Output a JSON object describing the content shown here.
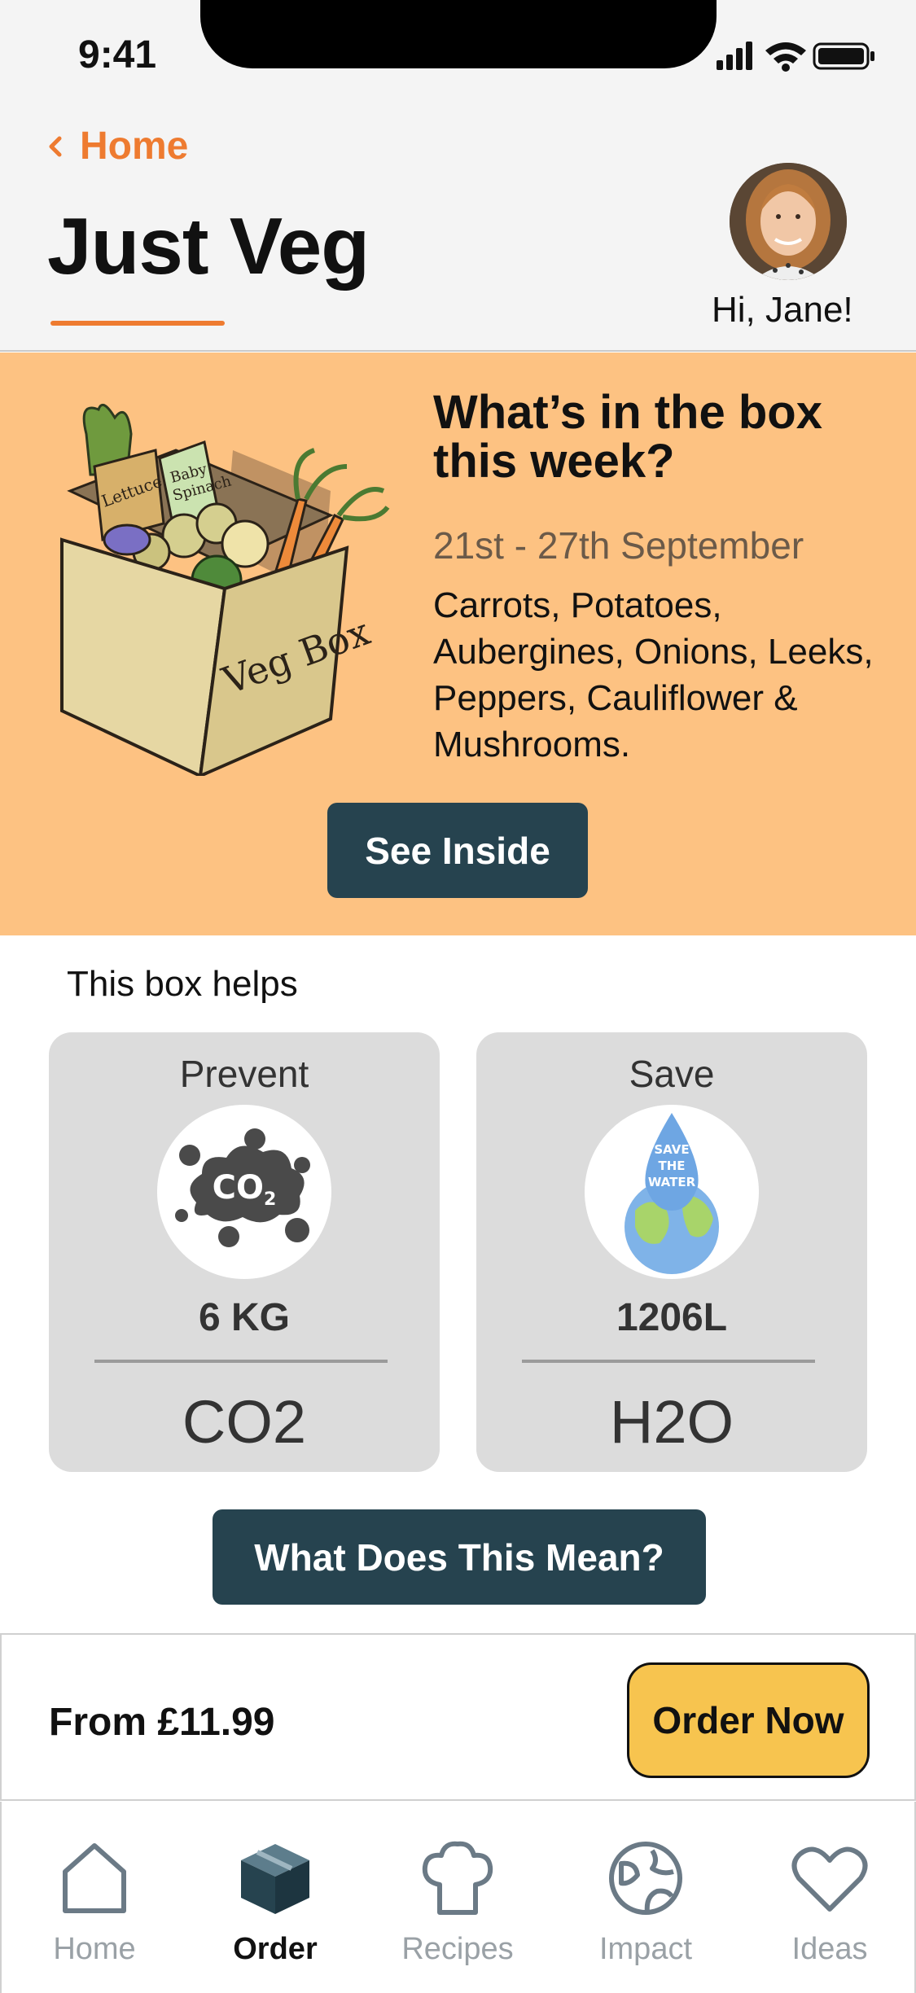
{
  "status_bar": {
    "time": "9:41"
  },
  "header": {
    "back_label": "Home",
    "title": "Just Veg",
    "greeting": "Hi, Jane!"
  },
  "banner": {
    "title": "What’s in the box this week?",
    "dates": "21st - 27th September",
    "items": "Carrots, Potatoes, Aubergines, Onions, Leeks, Peppers, Cauliflower & Mushrooms.",
    "button": "See Inside",
    "box_labels": [
      "Lettuce",
      "Baby Spinach",
      "Veg Box"
    ]
  },
  "helps": {
    "heading": "This box helps",
    "cards": [
      {
        "title": "Prevent",
        "amount": "6 KG",
        "unit": "CO2",
        "icon": "co2-cloud-icon",
        "icon_text": "CO2"
      },
      {
        "title": "Save",
        "amount": "1206L",
        "unit": "H2O",
        "icon": "water-drop-earth-icon",
        "icon_text": "SAVE THE WATER"
      }
    ],
    "button": "What Does This Mean?"
  },
  "order": {
    "price": "From £11.99",
    "button": "Order Now"
  },
  "tabs": [
    {
      "label": "Home",
      "icon": "home-icon",
      "active": false
    },
    {
      "label": "Order",
      "icon": "box-icon",
      "active": true
    },
    {
      "label": "Recipes",
      "icon": "chef-hat-icon",
      "active": false
    },
    {
      "label": "Impact",
      "icon": "globe-icon",
      "active": false
    },
    {
      "label": "Ideas",
      "icon": "heart-icon",
      "active": false
    }
  ],
  "colors": {
    "accent": "#ee7b30",
    "banner_bg": "#fdc282",
    "button_dark": "#26434f",
    "order_button": "#f7c44f",
    "card_bg": "#dcdcdc"
  }
}
